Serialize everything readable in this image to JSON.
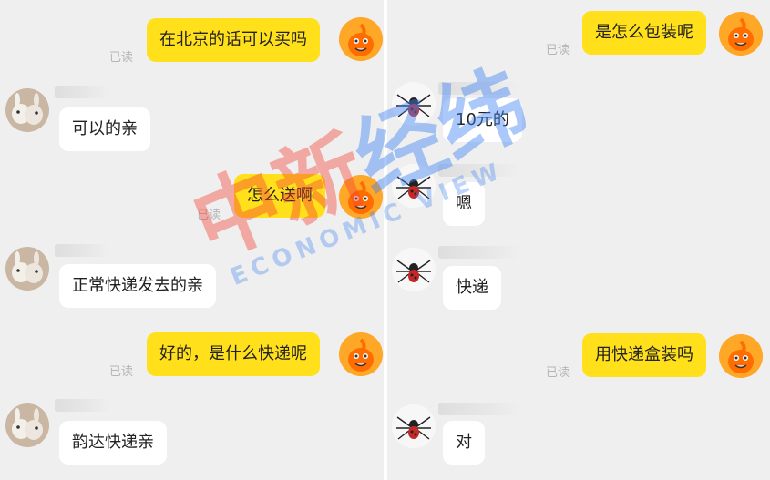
{
  "left_chat": {
    "messages": [
      {
        "side": "out",
        "text": "在北京的话可以买吗",
        "status": "已读"
      },
      {
        "side": "in",
        "text": "可以的亲"
      },
      {
        "side": "out",
        "text": "怎么送啊",
        "status": "已读"
      },
      {
        "side": "in",
        "text": "正常快递发去的亲"
      },
      {
        "side": "out",
        "text": "好的，是什么快递呢",
        "status": "已读"
      },
      {
        "side": "in",
        "text": "韵达快递亲"
      }
    ]
  },
  "right_chat": {
    "messages": [
      {
        "side": "out",
        "text": "是怎么包装呢",
        "status": "已读"
      },
      {
        "side": "in",
        "text": "10元的"
      },
      {
        "side": "in",
        "text": "嗯"
      },
      {
        "side": "in",
        "text": "快递"
      },
      {
        "side": "out",
        "text": "用快递盒装吗",
        "status": "已读"
      },
      {
        "side": "in",
        "text": "对"
      }
    ]
  },
  "watermark": {
    "cn_red": "中新",
    "cn_blue": "经纬",
    "en": "ECONOMIC VIEW"
  },
  "colors": {
    "outgoing_bubble": "#ffe01a",
    "incoming_bubble": "#ffffff",
    "background": "#efefef",
    "read_status": "#b5b5b5"
  },
  "icons": {
    "self_avatar": "orange-mascot-avatar",
    "left_contact_avatar": "bunny-avatar",
    "right_contact_avatar": "spider-avatar"
  }
}
